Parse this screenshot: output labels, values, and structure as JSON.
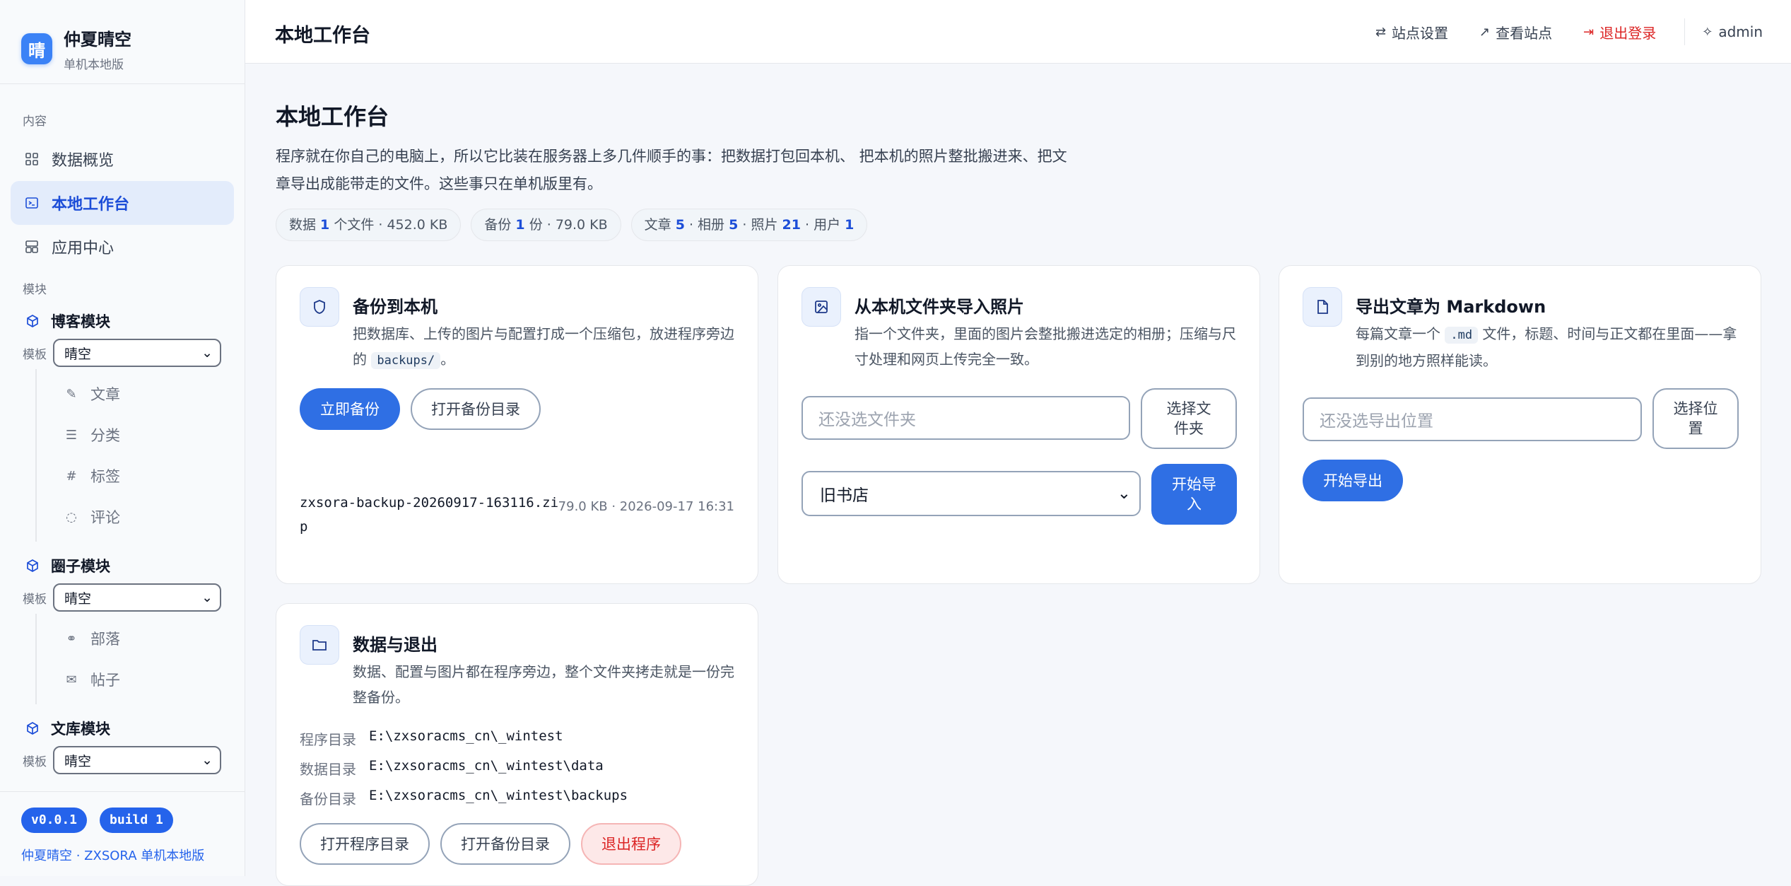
{
  "brand": {
    "logo_char": "晴",
    "name": "仲夏晴空",
    "subtitle": "单机本地版"
  },
  "sidebar": {
    "section_content": "内容",
    "items": [
      {
        "label": "数据概览",
        "icon": "grid-icon"
      },
      {
        "label": "本地工作台",
        "icon": "terminal-icon"
      },
      {
        "label": "应用中心",
        "icon": "apps-icon"
      }
    ],
    "section_modules": "模块",
    "template_label": "模板",
    "modules": [
      {
        "name": "博客模块",
        "template": "晴空",
        "subs": [
          {
            "label": "文章",
            "icon": "pencil-icon",
            "glyph": "✎"
          },
          {
            "label": "分类",
            "icon": "list-icon",
            "glyph": "☰"
          },
          {
            "label": "标签",
            "icon": "hash-icon",
            "glyph": "#"
          },
          {
            "label": "评论",
            "icon": "comment-icon",
            "glyph": "◌"
          }
        ]
      },
      {
        "name": "圈子模块",
        "template": "晴空",
        "subs": [
          {
            "label": "部落",
            "icon": "link-icon",
            "glyph": "⚭"
          },
          {
            "label": "帖子",
            "icon": "mail-icon",
            "glyph": "✉"
          }
        ]
      },
      {
        "name": "文库模块",
        "template": "晴空",
        "subs": []
      }
    ],
    "version": "v0.0.1",
    "build": "build 1",
    "footer": "仲夏晴空 · ZXSORA 单机本地版"
  },
  "header": {
    "title": "本地工作台",
    "actions": {
      "settings": "站点设置",
      "view_site": "查看站点",
      "logout": "退出登录",
      "user": "admin"
    }
  },
  "page": {
    "title": "本地工作台",
    "description": "程序就在你自己的电脑上，所以它比装在服务器上多几件顺手的事：把数据打包回本机、 把本机的照片整批搬进来、把文章导出成能带走的文件。这些事只在单机版里有。",
    "stats": {
      "data_pre": "数据 ",
      "data_count": "1",
      "data_post": " 个文件 · 452.0 KB",
      "backup_pre": "备份 ",
      "backup_count": "1",
      "backup_post": " 份 · 79.0 KB",
      "posts_pre": "文章 ",
      "posts": "5",
      "albums_pre": " · 相册 ",
      "albums": "5",
      "photos_pre": " · 照片 ",
      "photos": "21",
      "users_pre": " · 用户 ",
      "users": "1"
    }
  },
  "cards": {
    "backup": {
      "title": "备份到本机",
      "desc_1": "把数据库、上传的图片与配置打成一个压缩包，放进程序旁边的 ",
      "desc_code": "backups/",
      "desc_2": "。",
      "btn_backup": "立即备份",
      "btn_open": "打开备份目录",
      "file_name_1": "zxsora-backup-20260917-163116.zi",
      "file_name_2": "p",
      "file_meta": "79.0 KB · 2026-09-17 16:31"
    },
    "import": {
      "title": "从本机文件夹导入照片",
      "desc": "指一个文件夹，里面的图片会整批搬进选定的相册；压缩与尺寸处理和网页上传完全一致。",
      "folder_placeholder": "还没选文件夹",
      "btn_choose_1": "选择文",
      "btn_choose_2": "件夹",
      "album_selected": "旧书店",
      "btn_start_1": "开始导",
      "btn_start_2": "入"
    },
    "export": {
      "title": "导出文章为 Markdown",
      "desc_1": "每篇文章一个 ",
      "desc_code": ".md",
      "desc_2": " 文件，标题、时间与正文都在里面——拿到别的地方照样能读。",
      "location_placeholder": "还没选导出位置",
      "btn_choose_1": "选择位",
      "btn_choose_2": "置",
      "btn_export": "开始导出"
    },
    "data": {
      "title": "数据与退出",
      "desc": "数据、配置与图片都在程序旁边，整个文件夹拷走就是一份完整备份。",
      "rows": [
        {
          "k": "程序目录",
          "v": "E:\\zxsoracms_cn\\_wintest"
        },
        {
          "k": "数据目录",
          "v": "E:\\zxsoracms_cn\\_wintest\\data"
        },
        {
          "k": "备份目录",
          "v": "E:\\zxsoracms_cn\\_wintest\\backups"
        }
      ],
      "btn_open_program": "打开程序目录",
      "btn_open_backup": "打开备份目录",
      "btn_exit": "退出程序"
    }
  },
  "colors": {
    "accent": "#2f6fe4",
    "danger": "#dc2626",
    "active_bg": "#e3ecfb"
  }
}
